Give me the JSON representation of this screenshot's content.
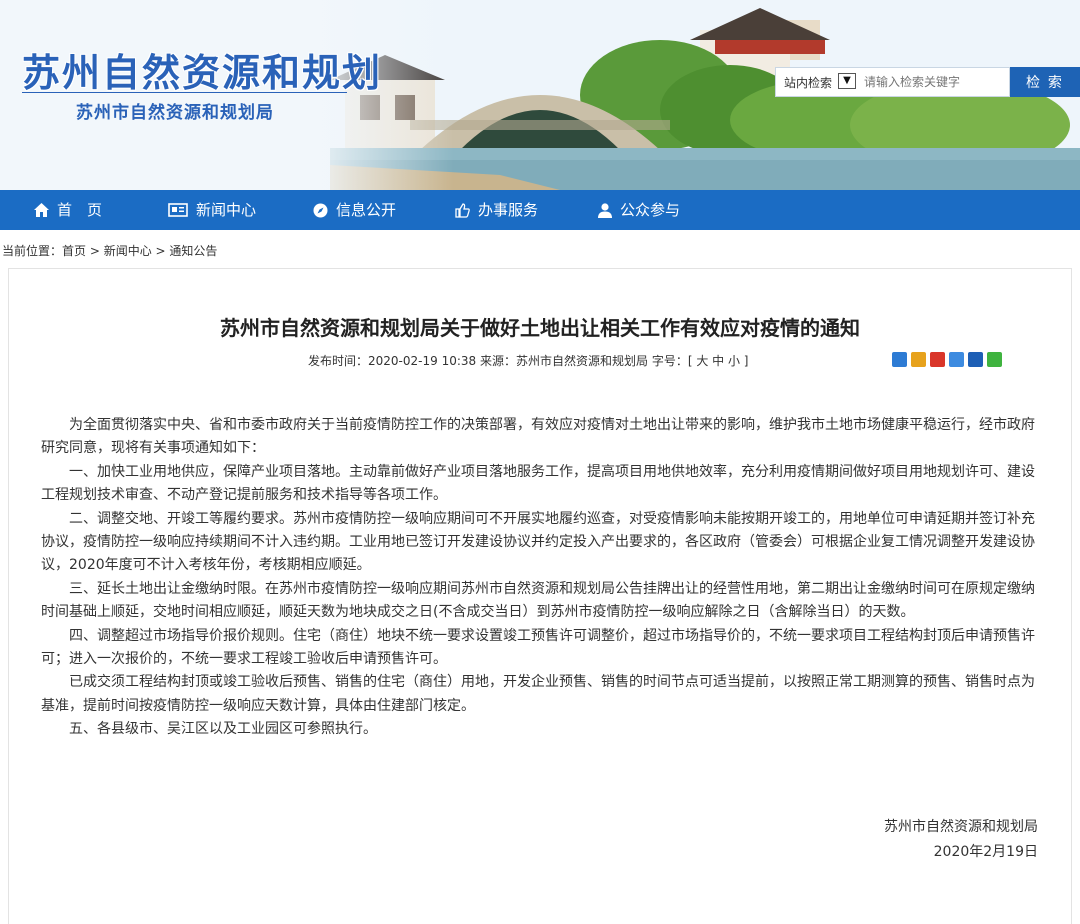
{
  "header": {
    "site_title": "苏州自然资源和规划",
    "site_subtitle": "苏州市自然资源和规划局"
  },
  "search": {
    "scope_label": "站内检索",
    "placeholder": "请输入检索关键字",
    "button_label": "检 索"
  },
  "nav": {
    "items": [
      {
        "label": "首　页",
        "icon": "home-icon"
      },
      {
        "label": "新闻中心",
        "icon": "newspaper-icon"
      },
      {
        "label": "信息公开",
        "icon": "compass-icon"
      },
      {
        "label": "办事服务",
        "icon": "thumbs-up-icon"
      },
      {
        "label": "公众参与",
        "icon": "user-icon"
      }
    ]
  },
  "breadcrumb": {
    "prefix": "当前位置：",
    "items": [
      "首页",
      "新闻中心",
      "通知公告"
    ],
    "separator": " > "
  },
  "article": {
    "title": "苏州市自然资源和规划局关于做好土地出让相关工作有效应对疫情的通知",
    "publish_label": "发布时间：",
    "publish_time": "2020-02-19 10:38",
    "source_label": "来源：",
    "source": "苏州市自然资源和规划局",
    "font_label": "字号：",
    "font_sizes": "[ 大 中 小 ]",
    "paragraphs": [
      "为全面贯彻落实中央、省和市委市政府关于当前疫情防控工作的决策部署，有效应对疫情对土地出让带来的影响，维护我市土地市场健康平稳运行，经市政府研究同意，现将有关事项通知如下：",
      "一、加快工业用地供应，保障产业项目落地。主动靠前做好产业项目落地服务工作，提高项目用地供地效率，充分利用疫情期间做好项目用地规划许可、建设工程规划技术审查、不动产登记提前服务和技术指导等各项工作。",
      "二、调整交地、开竣工等履约要求。苏州市疫情防控一级响应期间可不开展实地履约巡查，对受疫情影响未能按期开竣工的，用地单位可申请延期并签订补充协议，疫情防控一级响应持续期间不计入违约期。工业用地已签订开发建设协议并约定投入产出要求的，各区政府（管委会）可根据企业复工情况调整开发建设协议，2020年度可不计入考核年份，考核期相应顺延。",
      "三、延长土地出让金缴纳时限。在苏州市疫情防控一级响应期间苏州市自然资源和规划局公告挂牌出让的经营性用地，第二期出让金缴纳时间可在原规定缴纳时间基础上顺延，交地时间相应顺延，顺延天数为地块成交之日(不含成交当日）到苏州市疫情防控一级响应解除之日（含解除当日）的天数。",
      "四、调整超过市场指导价报价规则。住宅（商住）地块不统一要求设置竣工预售许可调整价，超过市场指导价的，不统一要求项目工程结构封顶后申请预售许可；进入一次报价的，不统一要求工程竣工验收后申请预售许可。",
      "已成交须工程结构封顶或竣工验收后预售、销售的住宅（商住）用地，开发企业预售、销售的时间节点可适当提前，以按照正常工期测算的预售、销售时点为基准，提前时间按疫情防控一级响应天数计算，具体由住建部门核定。",
      "五、各县级市、吴江区以及工业园区可参照执行。"
    ],
    "signature_org": "苏州市自然资源和规划局",
    "signature_date": "2020年2月19日"
  },
  "share_icons": [
    {
      "name": "share-plus-icon",
      "color": "#2d7bd4"
    },
    {
      "name": "share-qzone-icon",
      "color": "#e7a21c"
    },
    {
      "name": "share-weibo-icon",
      "color": "#d9362a"
    },
    {
      "name": "share-qq-icon",
      "color": "#3d8be0"
    },
    {
      "name": "share-renren-icon",
      "color": "#1e5fb5"
    },
    {
      "name": "share-wechat-icon",
      "color": "#3fb33f"
    }
  ],
  "colors": {
    "nav_bg": "#1b6cc4",
    "title_blue": "#2a62b8",
    "search_button": "#1e63b5"
  }
}
